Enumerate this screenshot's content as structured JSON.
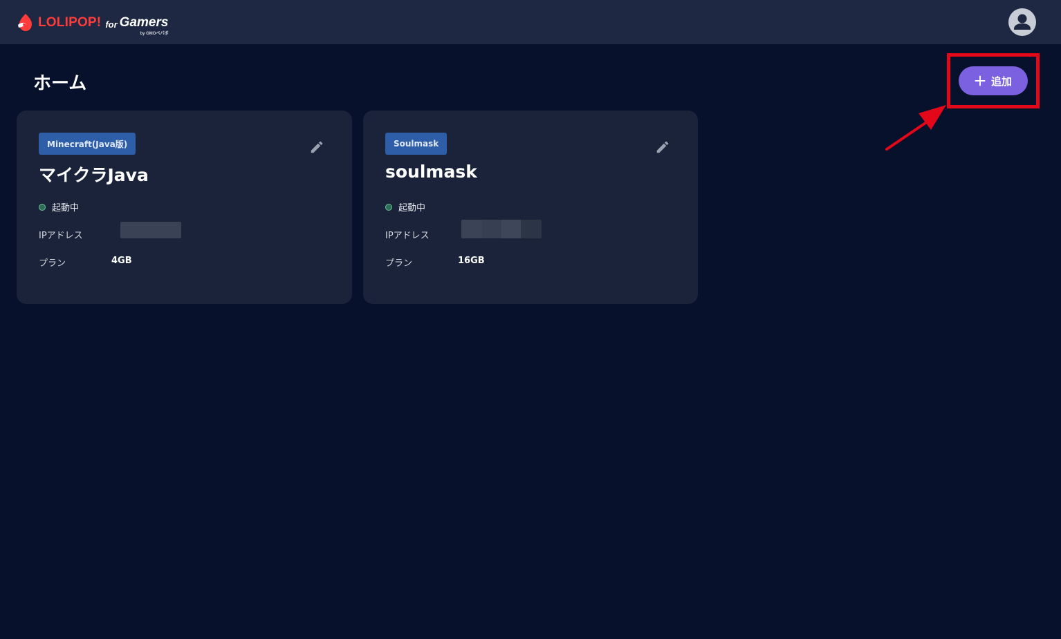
{
  "header": {
    "brand": "LOLIPOP!",
    "brand_for": "for",
    "brand_product": "Gamers",
    "brand_by": "by GMOペパボ",
    "icons": {
      "logo": "lollipop-logo-icon",
      "account": "account-avatar-icon"
    }
  },
  "page": {
    "title": "ホーム",
    "add_button_label": "追加",
    "add_icon": "plus-icon"
  },
  "colors": {
    "background": "#07112b",
    "header": "#1e2842",
    "card": "#1a2339",
    "accent": "#7b61e0",
    "tag": "#2f5ea8",
    "status_running": "#2b6e55",
    "annotation": "#e3071a"
  },
  "servers": [
    {
      "tag": "Minecraft(Java版)",
      "name": "マイクラJava",
      "status": "起動中",
      "ip_label": "IPアドレス",
      "plan_label": "プラン",
      "plan_value": "4GB"
    },
    {
      "tag": "Soulmask",
      "name": "soulmask",
      "status": "起動中",
      "ip_label": "IPアドレス",
      "plan_label": "プラン",
      "plan_value": "16GB"
    }
  ]
}
